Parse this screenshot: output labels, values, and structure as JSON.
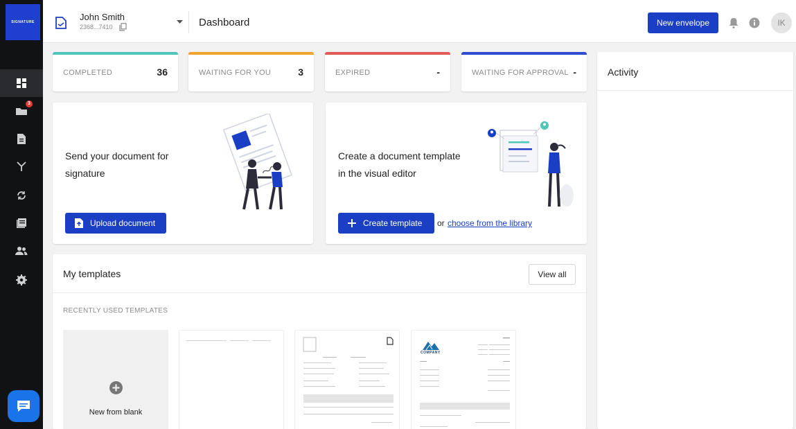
{
  "sidebar": {
    "logo_text": "SIGNATURE",
    "items": [
      {
        "icon": "dashboard-icon",
        "active": true
      },
      {
        "icon": "inbox-icon",
        "badge": "3"
      },
      {
        "icon": "document-icon"
      },
      {
        "icon": "workflow-icon"
      },
      {
        "icon": "sync-icon"
      },
      {
        "icon": "templates-icon"
      },
      {
        "icon": "contacts-icon"
      },
      {
        "icon": "settings-icon"
      }
    ],
    "chat_icon": "chat-icon"
  },
  "header": {
    "account_name": "John Smith",
    "account_id": "2368...7410",
    "page_title": "Dashboard",
    "new_envelope_label": "New envelope",
    "avatar_initials": "IK"
  },
  "stats": [
    {
      "label": "COMPLETED",
      "value": "36",
      "color": "#4fc7b8"
    },
    {
      "label": "WAITING FOR YOU",
      "value": "3",
      "color": "#f0a530"
    },
    {
      "label": "EXPIRED",
      "value": "-",
      "color": "#e05a5a"
    },
    {
      "label": "WAITING FOR APPROVAL",
      "value": "-",
      "color": "#2f4bd0"
    }
  ],
  "send_card": {
    "text": "Send your document for signature",
    "button_label": "Upload document"
  },
  "template_card": {
    "text": "Create a document template in the visual editor",
    "button_label": "Create template",
    "or_text": "or",
    "link_text": "choose from the library"
  },
  "templates": {
    "title": "My templates",
    "view_all_label": "View all",
    "section_label": "RECENTLY USED TEMPLATES",
    "new_blank_label": "New from blank",
    "company_logo_text": "COMPANY"
  },
  "activity": {
    "title": "Activity"
  },
  "colors": {
    "accent": "#1a3fc4",
    "sidebar_bg": "#111214",
    "logo_bg": "#1f3fcf"
  }
}
